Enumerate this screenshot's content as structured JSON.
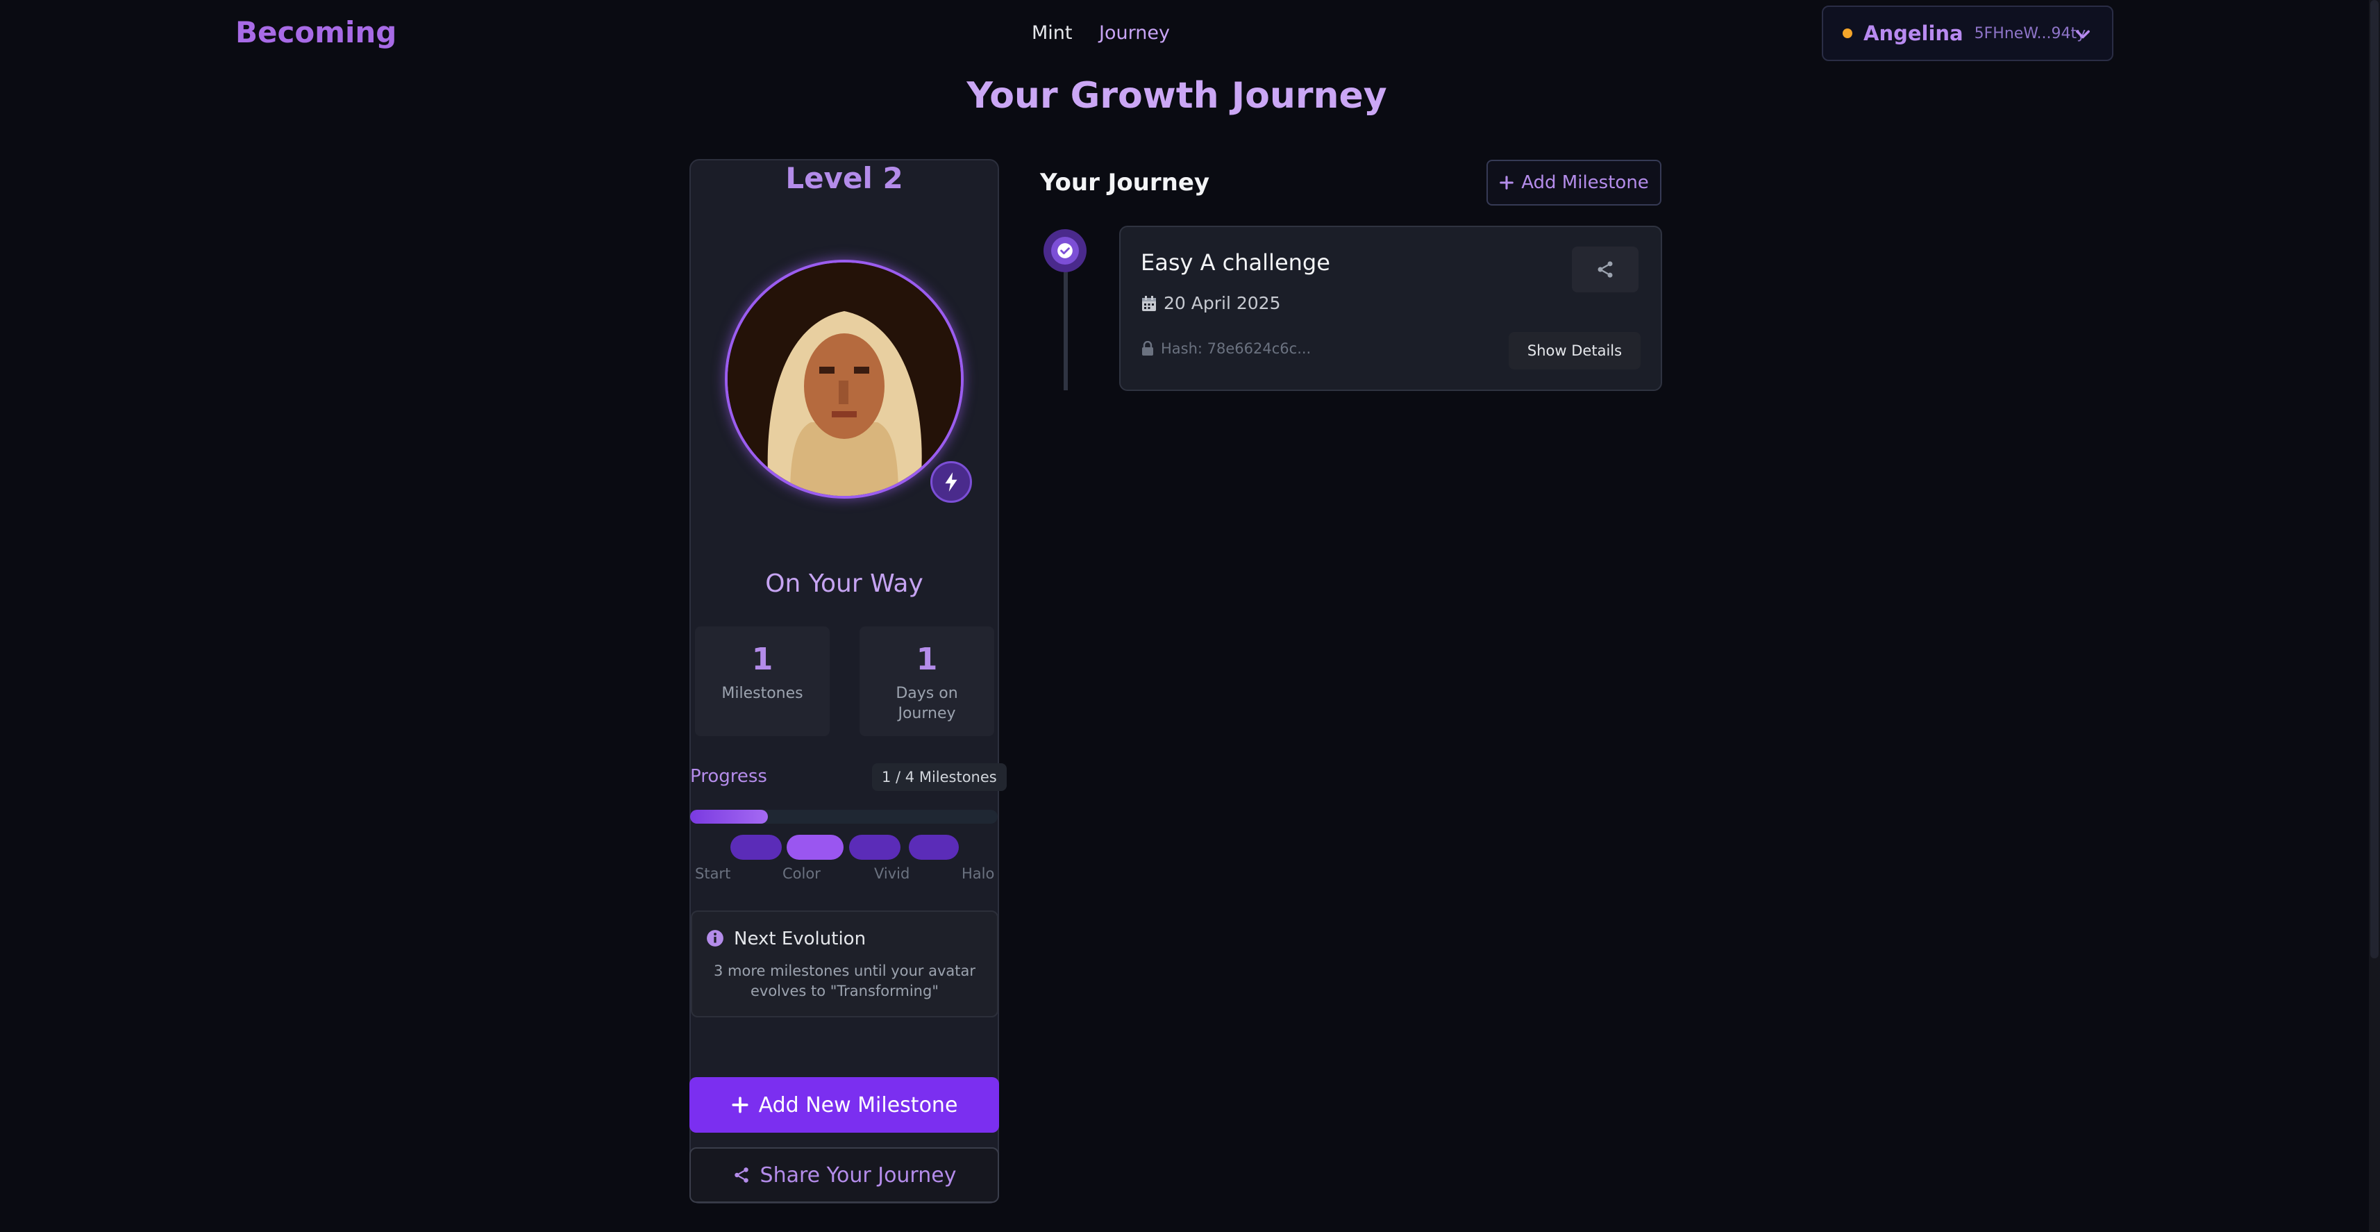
{
  "header": {
    "brand": "Becoming",
    "nav": [
      {
        "label": "Mint"
      },
      {
        "label": "Journey"
      }
    ],
    "wallet": {
      "name": "Angelina",
      "address": "5FHneW...94ty",
      "status_color": "#f4a52a"
    }
  },
  "page_title": "Your Growth Journey",
  "profile": {
    "level": "Level 2",
    "status": "On Your Way",
    "stats": [
      {
        "value": "1",
        "label": "Milestones"
      },
      {
        "value": "1",
        "label": "Days on Journey"
      }
    ],
    "progress": {
      "label": "Progress",
      "count_text": "1 / 4 Milestones",
      "fraction": 0.25,
      "stages": [
        "Start",
        "Color",
        "Vivid",
        "Halo"
      ],
      "active_stage": "Color"
    },
    "next_evolution": {
      "title": "Next Evolution",
      "description": "3 more milestones until your avatar evolves to \"Transforming\""
    },
    "add_button": "Add New Milestone",
    "share_button": "Share Your Journey"
  },
  "journey": {
    "title": "Your Journey",
    "add_button": "Add Milestone",
    "milestones": [
      {
        "title": "Easy A challenge",
        "date": "20 April 2025",
        "hash": "Hash: 78e6624c6c...",
        "details_button": "Show Details"
      }
    ]
  },
  "colors": {
    "accent": "#7b2ff0",
    "accent_text": "#b48cea",
    "background": "#0a0b12"
  }
}
